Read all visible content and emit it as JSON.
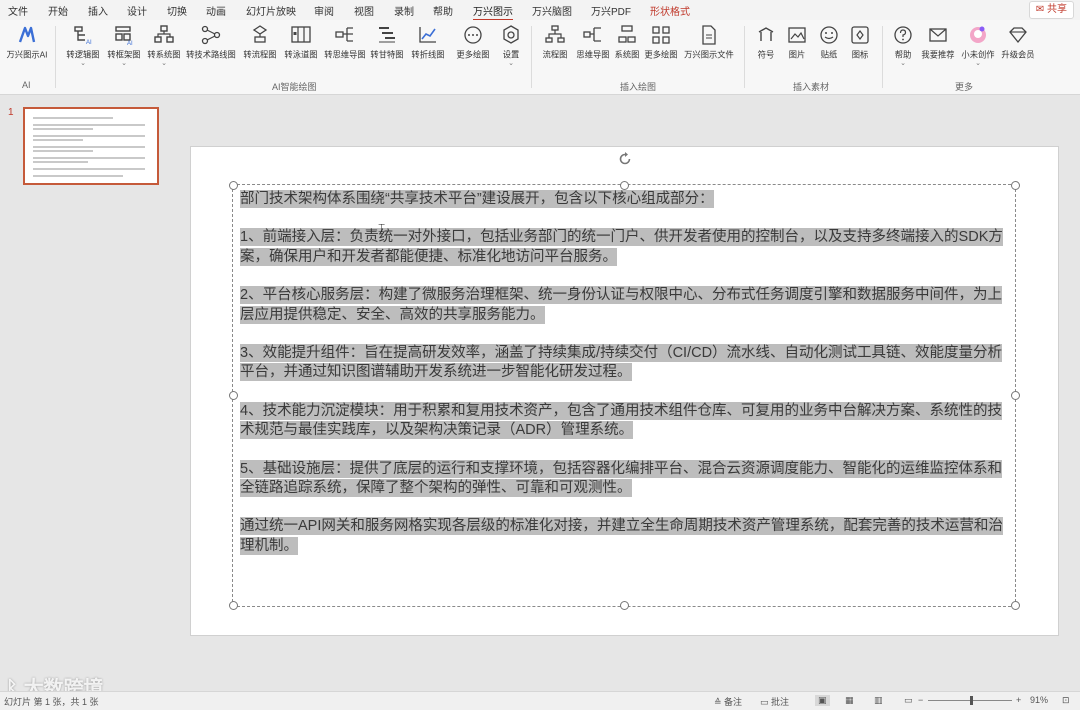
{
  "menu": {
    "tabs": [
      "文件",
      "开始",
      "插入",
      "设计",
      "切换",
      "动画",
      "幻灯片放映",
      "审阅",
      "视图",
      "录制",
      "帮助",
      "万兴图示",
      "万兴脑图",
      "万兴PDF",
      "形状格式"
    ],
    "share": "共享"
  },
  "ribbon": {
    "ai_button": "万兴图示AI",
    "ai_buttons": [
      "转逻辑图",
      "转框架图",
      "转系统图",
      "转技术路线图",
      "转流程图",
      "转泳道图",
      "转思维导图",
      "转甘特图",
      "转折线图",
      "更多绘图",
      "设置"
    ],
    "insert_buttons": [
      "流程图",
      "思维导图",
      "系统图",
      "更多绘图",
      "万兴图示文件"
    ],
    "material_buttons": [
      "符号",
      "图片",
      "贴纸",
      "图标"
    ],
    "more_buttons": [
      "帮助",
      "我要推荐",
      "小未创作",
      "升级会员"
    ],
    "groups": {
      "ai": "AI",
      "ai_draw": "AI智能绘图",
      "insert_draw": "插入绘图",
      "insert_material": "插入素材",
      "more": "更多"
    }
  },
  "thumbnails": {
    "slide_number": "1"
  },
  "slide": {
    "paragraphs": [
      "部门技术架构体系围绕“共享技术平台”建设展开，包含以下核心组成部分：",
      "1、前端接入层：负责统一对外接口，包括业务部门的统一门户、供开发者使用的控制台，以及支持多终端接入的SDK方案，确保用户和开发者都能便捷、标准化地访问平台服务。",
      "2、平台核心服务层：构建了微服务治理框架、统一身份认证与权限中心、分布式任务调度引擎和数据服务中间件，为上层应用提供稳定、安全、高效的共享服务能力。",
      "3、效能提升组件：旨在提高研发效率，涵盖了持续集成/持续交付（CI/CD）流水线、自动化测试工具链、效能度量分析平台，并通过知识图谱辅助开发系统进一步智能化研发过程。",
      "4、技术能力沉淀模块：用于积累和复用技术资产，包含了通用技术组件仓库、可复用的业务中台解决方案、系统性的技术规范与最佳实践库，以及架构决策记录（ADR）管理系统。",
      "5、基础设施层：提供了底层的运行和支撑环境，包括容器化编排平台、混合云资源调度能力、智能化的运维监控体系和全链路追踪系统，保障了整个架构的弹性、可靠和可观测性。",
      "通过统一API网关和服务网格实现各层级的标准化对接，并建立全生命周期技术资产管理系统，配套完善的技术运营和治理机制。"
    ]
  },
  "status": {
    "slide_info": "幻灯片 第 1 张，共 1 张",
    "notes": "备注",
    "comments": "批注",
    "zoom": "91%"
  },
  "watermark": "大数跨境"
}
